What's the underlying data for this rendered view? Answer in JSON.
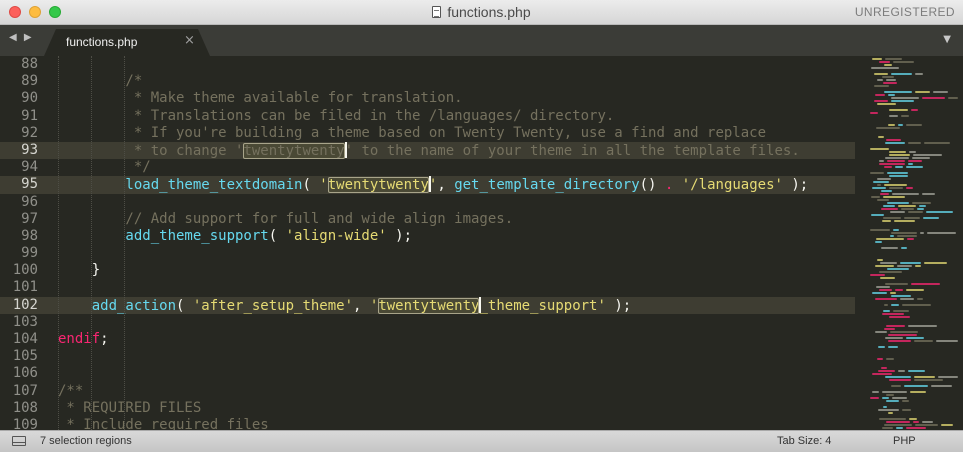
{
  "window": {
    "title": "functions.php",
    "license_label": "UNREGISTERED"
  },
  "tabs": {
    "nav_arrows": "◀ ▶",
    "active": {
      "label": "functions.php",
      "close_glyph": "×"
    },
    "menu_glyph": "▼"
  },
  "editor": {
    "lines": [
      {
        "n": "88",
        "active": false,
        "tokens": []
      },
      {
        "n": "89",
        "active": false,
        "tokens": [
          {
            "c": "c",
            "t": "        /*"
          }
        ]
      },
      {
        "n": "90",
        "active": false,
        "tokens": [
          {
            "c": "c",
            "t": "         * Make theme available for translation."
          }
        ]
      },
      {
        "n": "91",
        "active": false,
        "tokens": [
          {
            "c": "c",
            "t": "         * Translations can be filed in the /languages/ directory."
          }
        ]
      },
      {
        "n": "92",
        "active": false,
        "tokens": [
          {
            "c": "c",
            "t": "         * If you're building a theme based on Twenty Twenty, use a find and replace"
          }
        ]
      },
      {
        "n": "93",
        "active": true,
        "tokens": [
          {
            "c": "c",
            "t": "         * to change '"
          },
          {
            "c": "c hl",
            "t": "twentytwenty"
          },
          {
            "c": "cursor",
            "t": ""
          },
          {
            "c": "c",
            "t": "' to the name of your theme in all the template files."
          }
        ]
      },
      {
        "n": "94",
        "active": false,
        "tokens": [
          {
            "c": "c",
            "t": "         */"
          }
        ]
      },
      {
        "n": "95",
        "active": true,
        "tokens": [
          {
            "c": "f",
            "t": "        load_theme_textdomain"
          },
          {
            "c": "p",
            "t": "( "
          },
          {
            "c": "s",
            "t": "'"
          },
          {
            "c": "s hl",
            "t": "twentytwenty"
          },
          {
            "c": "cursor",
            "t": ""
          },
          {
            "c": "s",
            "t": "'"
          },
          {
            "c": "p",
            "t": ", "
          },
          {
            "c": "f",
            "t": "get_template_directory"
          },
          {
            "c": "p",
            "t": "() "
          },
          {
            "c": "k",
            "t": "."
          },
          {
            "c": "p",
            "t": " "
          },
          {
            "c": "s",
            "t": "'/languages'"
          },
          {
            "c": "p",
            "t": " );"
          }
        ]
      },
      {
        "n": "96",
        "active": false,
        "tokens": []
      },
      {
        "n": "97",
        "active": false,
        "tokens": [
          {
            "c": "c",
            "t": "        // Add support for full and wide align images."
          }
        ]
      },
      {
        "n": "98",
        "active": false,
        "tokens": [
          {
            "c": "f",
            "t": "        add_theme_support"
          },
          {
            "c": "p",
            "t": "( "
          },
          {
            "c": "s",
            "t": "'align-wide'"
          },
          {
            "c": "p",
            "t": " );"
          }
        ]
      },
      {
        "n": "99",
        "active": false,
        "tokens": []
      },
      {
        "n": "100",
        "active": false,
        "tokens": [
          {
            "c": "p",
            "t": "    }"
          }
        ]
      },
      {
        "n": "101",
        "active": false,
        "tokens": []
      },
      {
        "n": "102",
        "active": true,
        "tokens": [
          {
            "c": "f",
            "t": "    add_action"
          },
          {
            "c": "p",
            "t": "( "
          },
          {
            "c": "s",
            "t": "'after_setup_theme'"
          },
          {
            "c": "p",
            "t": ", "
          },
          {
            "c": "s",
            "t": "'"
          },
          {
            "c": "s hl",
            "t": "twentytwenty"
          },
          {
            "c": "cursor",
            "t": ""
          },
          {
            "c": "s",
            "t": "_theme_support'"
          },
          {
            "c": "p",
            "t": " );"
          }
        ]
      },
      {
        "n": "103",
        "active": false,
        "tokens": []
      },
      {
        "n": "104",
        "active": false,
        "tokens": [
          {
            "c": "k",
            "t": "endif"
          },
          {
            "c": "p",
            "t": ";"
          }
        ]
      },
      {
        "n": "105",
        "active": false,
        "tokens": []
      },
      {
        "n": "106",
        "active": false,
        "tokens": []
      },
      {
        "n": "107",
        "active": false,
        "tokens": [
          {
            "c": "c",
            "t": "/**"
          }
        ]
      },
      {
        "n": "108",
        "active": false,
        "tokens": [
          {
            "c": "c",
            "t": " * REQUIRED FILES"
          }
        ]
      },
      {
        "n": "109",
        "active": false,
        "tokens": [
          {
            "c": "c",
            "t": " * Include required files"
          }
        ]
      }
    ]
  },
  "status": {
    "selection": "7 selection regions",
    "tab_size": "Tab Size: 4",
    "syntax": "PHP"
  },
  "colors": {
    "background": "#272822",
    "comment": "#75715e",
    "function": "#66d9ef",
    "string": "#e6db74",
    "keyword": "#f92672",
    "text": "#f8f8f2"
  }
}
